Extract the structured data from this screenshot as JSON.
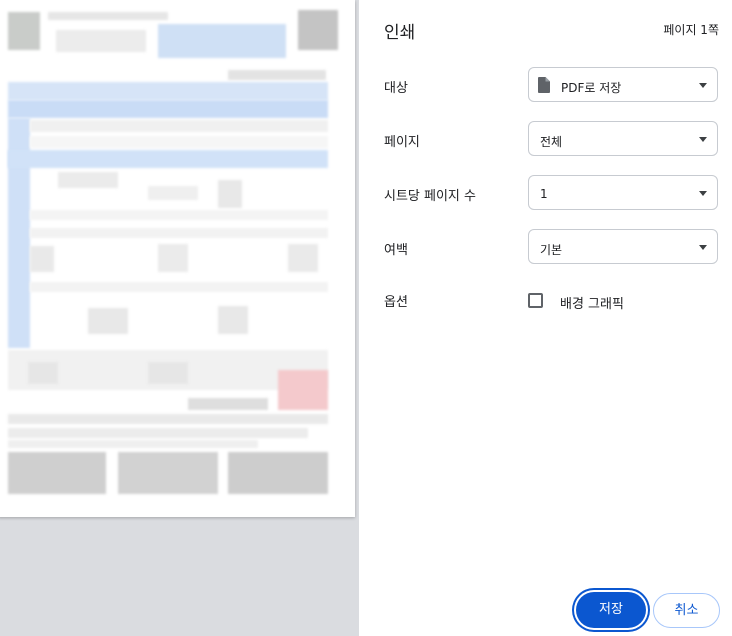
{
  "dialog": {
    "title": "인쇄",
    "page_count": "페이지 1쪽"
  },
  "settings": {
    "destination": {
      "label": "대상",
      "value": "PDF로 저장",
      "icon": "file-icon"
    },
    "pages": {
      "label": "페이지",
      "value": "전체"
    },
    "pages_per_sheet": {
      "label": "시트당 페이지 수",
      "value": "1"
    },
    "margins": {
      "label": "여백",
      "value": "기본"
    },
    "options": {
      "label": "옵션",
      "checkbox_label": "배경 그래픽",
      "checked": false
    }
  },
  "buttons": {
    "save": "저장",
    "cancel": "취소"
  },
  "colors": {
    "accent": "#0b57d0",
    "preview_background": "#dadce0",
    "border": "#c7cbd1"
  }
}
